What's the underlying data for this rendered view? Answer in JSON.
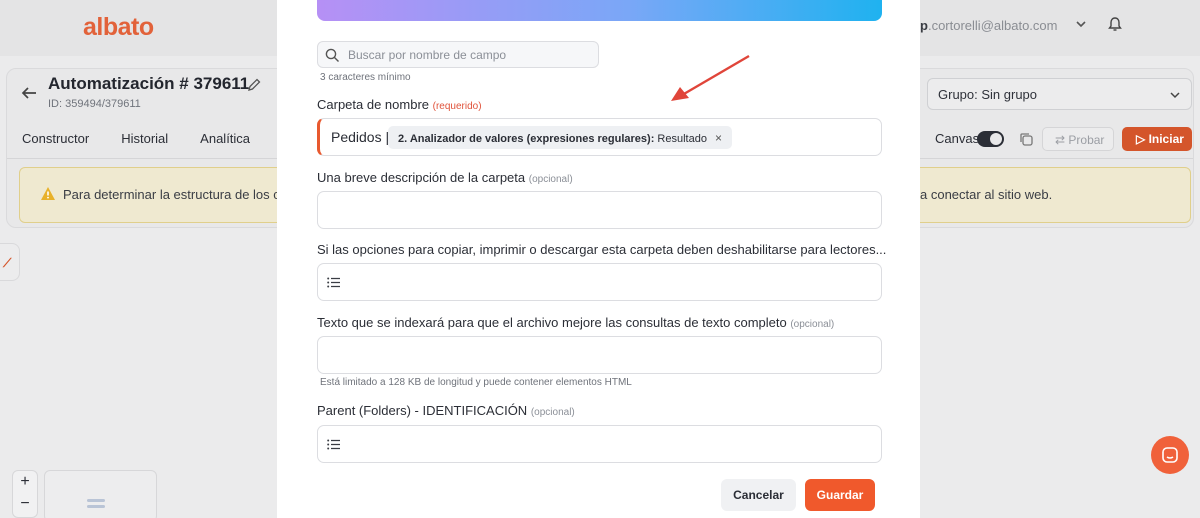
{
  "app": {
    "logo": "albato",
    "user_email_prefix": "p",
    "user_email": ".cortorelli@albato.com",
    "automation_title": "Automatización # 379611",
    "automation_id": "ID: 359494/379611",
    "tabs": [
      "Constructor",
      "Historial",
      "Analítica"
    ],
    "group_select": "Grupo: Sin grupo",
    "canvas_label": "Canvas",
    "canvas_toggle_on": true,
    "probar_label": "Probar",
    "iniciar_label": "Iniciar",
    "warning_left": "Para determinar la estructura de los c",
    "warning_right": "a conectar al sitio web.",
    "zoom_in": "+",
    "zoom_out": "−",
    "accent_color": "#f0592c"
  },
  "modal": {
    "search": {
      "placeholder": "Buscar por nombre de campo",
      "value": ""
    },
    "search_hint": "3 caracteres mínimo",
    "fields": [
      {
        "label": "Carpeta de nombre",
        "tag": "(requerido)",
        "text_value": "Pedidos |",
        "chip_bold": "2. Analizador de valores (expresiones regulares):",
        "chip_text": "Resultado",
        "chip_remove": "×"
      },
      {
        "label": "Una breve descripción de la carpeta",
        "tag": "(opcional)"
      },
      {
        "label": "Si las opciones para copiar, imprimir o descargar esta carpeta deben deshabilitarse para lectores...",
        "tag": "",
        "icon": "list-icon"
      },
      {
        "label": "Texto que se indexará para que el archivo mejore las consultas de texto completo",
        "tag": "(opcional)",
        "helper": "Está limitado a 128 KB de longitud y puede contener elementos HTML"
      },
      {
        "label": "Parent (Folders) - IDENTIFICACIÓN",
        "tag": "(opcional)",
        "icon": "list-icon"
      }
    ],
    "cancel_label": "Cancelar",
    "save_label": "Guardar",
    "annotation_arrow_color": "#e0453a"
  }
}
